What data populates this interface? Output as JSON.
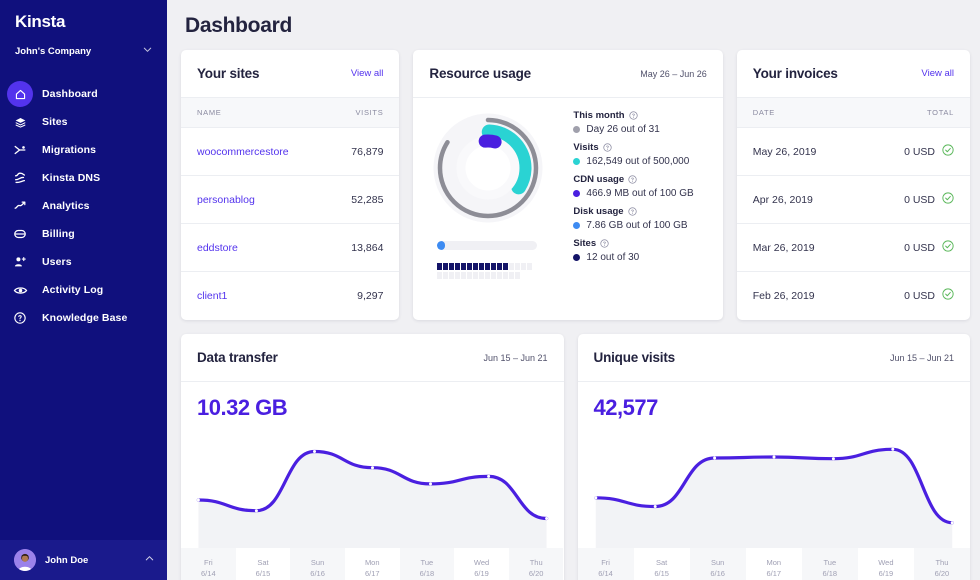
{
  "brand": {
    "logo_text": "Kinsta",
    "accent": "#5333ed",
    "sidebar_bg": "#10107d"
  },
  "sidebar": {
    "company": "John's Company",
    "items": [
      {
        "label": "Dashboard",
        "icon": "home-icon",
        "active": true
      },
      {
        "label": "Sites",
        "icon": "layers-icon",
        "active": false
      },
      {
        "label": "Migrations",
        "icon": "migration-arrow-icon",
        "active": false
      },
      {
        "label": "Kinsta DNS",
        "icon": "dns-icon",
        "active": false
      },
      {
        "label": "Analytics",
        "icon": "analytics-trend-icon",
        "active": false
      },
      {
        "label": "Billing",
        "icon": "credit-card-icon",
        "active": false
      },
      {
        "label": "Users",
        "icon": "user-plus-icon",
        "active": false
      },
      {
        "label": "Activity Log",
        "icon": "eye-icon",
        "active": false
      },
      {
        "label": "Knowledge Base",
        "icon": "question-circle-icon",
        "active": false
      }
    ],
    "user": {
      "name": "John Doe"
    }
  },
  "header": {
    "title": "Dashboard"
  },
  "sites_card": {
    "title": "Your sites",
    "view_all": "View all",
    "columns": [
      "NAME",
      "VISITS"
    ],
    "rows": [
      {
        "name": "woocommercestore",
        "visits": "76,879"
      },
      {
        "name": "personablog",
        "visits": "52,285"
      },
      {
        "name": "eddstore",
        "visits": "13,864"
      },
      {
        "name": "client1",
        "visits": "9,297"
      }
    ]
  },
  "resource_card": {
    "title": "Resource usage",
    "date_range": "May 26 – Jun 26",
    "progress_percent": 8,
    "dots_filled": 12,
    "dots_total": 30,
    "metrics": [
      {
        "label": "This month",
        "value": "Day 26 out of 31",
        "color": "#a0a0ac"
      },
      {
        "label": "Visits",
        "value": "162,549 out of 500,000",
        "color": "#2ad3d3"
      },
      {
        "label": "CDN usage",
        "value": "466.9 MB out of 100 GB",
        "color": "#4a1fe0"
      },
      {
        "label": "Disk usage",
        "value": "7.86 GB out of 100 GB",
        "color": "#3d8bf2"
      },
      {
        "label": "Sites",
        "value": "12 out of 30",
        "color": "#141468"
      }
    ],
    "donut": {
      "outer_gray_percent": 84,
      "teal_percent": 33,
      "purple_percent": 6
    }
  },
  "invoices_card": {
    "title": "Your invoices",
    "view_all": "View all",
    "columns": [
      "DATE",
      "TOTAL"
    ],
    "rows": [
      {
        "date": "May 26, 2019",
        "total": "0 USD",
        "status": "paid"
      },
      {
        "date": "Apr 26, 2019",
        "total": "0 USD",
        "status": "paid"
      },
      {
        "date": "Mar 26, 2019",
        "total": "0 USD",
        "status": "paid"
      },
      {
        "date": "Feb 26, 2019",
        "total": "0 USD",
        "status": "paid"
      }
    ]
  },
  "chart_data": [
    {
      "type": "line",
      "title": "Data transfer",
      "subtitle": "Jun 15 – Jun 21",
      "metric": "10.32 GB",
      "xlabel": "",
      "ylabel": "",
      "categories": [
        "Fri",
        "Sat",
        "Sun",
        "Mon",
        "Tue",
        "Wed",
        "Thu"
      ],
      "tick_dates": [
        "6/14",
        "6/15",
        "6/16",
        "6/17",
        "6/18",
        "6/19",
        "6/20"
      ],
      "x": [
        0,
        1,
        2,
        3,
        4,
        5,
        6
      ],
      "values": [
        1.05,
        0.72,
        2.55,
        2.05,
        1.55,
        1.78,
        0.48
      ],
      "ylim": [
        0,
        3
      ],
      "grid": false,
      "legend": "none",
      "line_color": "#4a1fe0",
      "fill_color": "#f2f3f6"
    },
    {
      "type": "line",
      "title": "Unique visits",
      "subtitle": "Jun 15 – Jun 21",
      "metric": "42,577",
      "xlabel": "",
      "ylabel": "",
      "categories": [
        "Fri",
        "Sat",
        "Sun",
        "Mon",
        "Tue",
        "Wed",
        "Thu"
      ],
      "tick_dates": [
        "6/14",
        "6/15",
        "6/16",
        "6/17",
        "6/18",
        "6/19",
        "6/20"
      ],
      "x": [
        0,
        1,
        2,
        3,
        4,
        5,
        6
      ],
      "values": [
        1.12,
        0.85,
        2.35,
        2.38,
        2.33,
        2.62,
        0.35
      ],
      "ylim": [
        0,
        3
      ],
      "grid": false,
      "legend": "none",
      "line_color": "#4a1fe0",
      "fill_color": "#f2f3f6"
    }
  ]
}
